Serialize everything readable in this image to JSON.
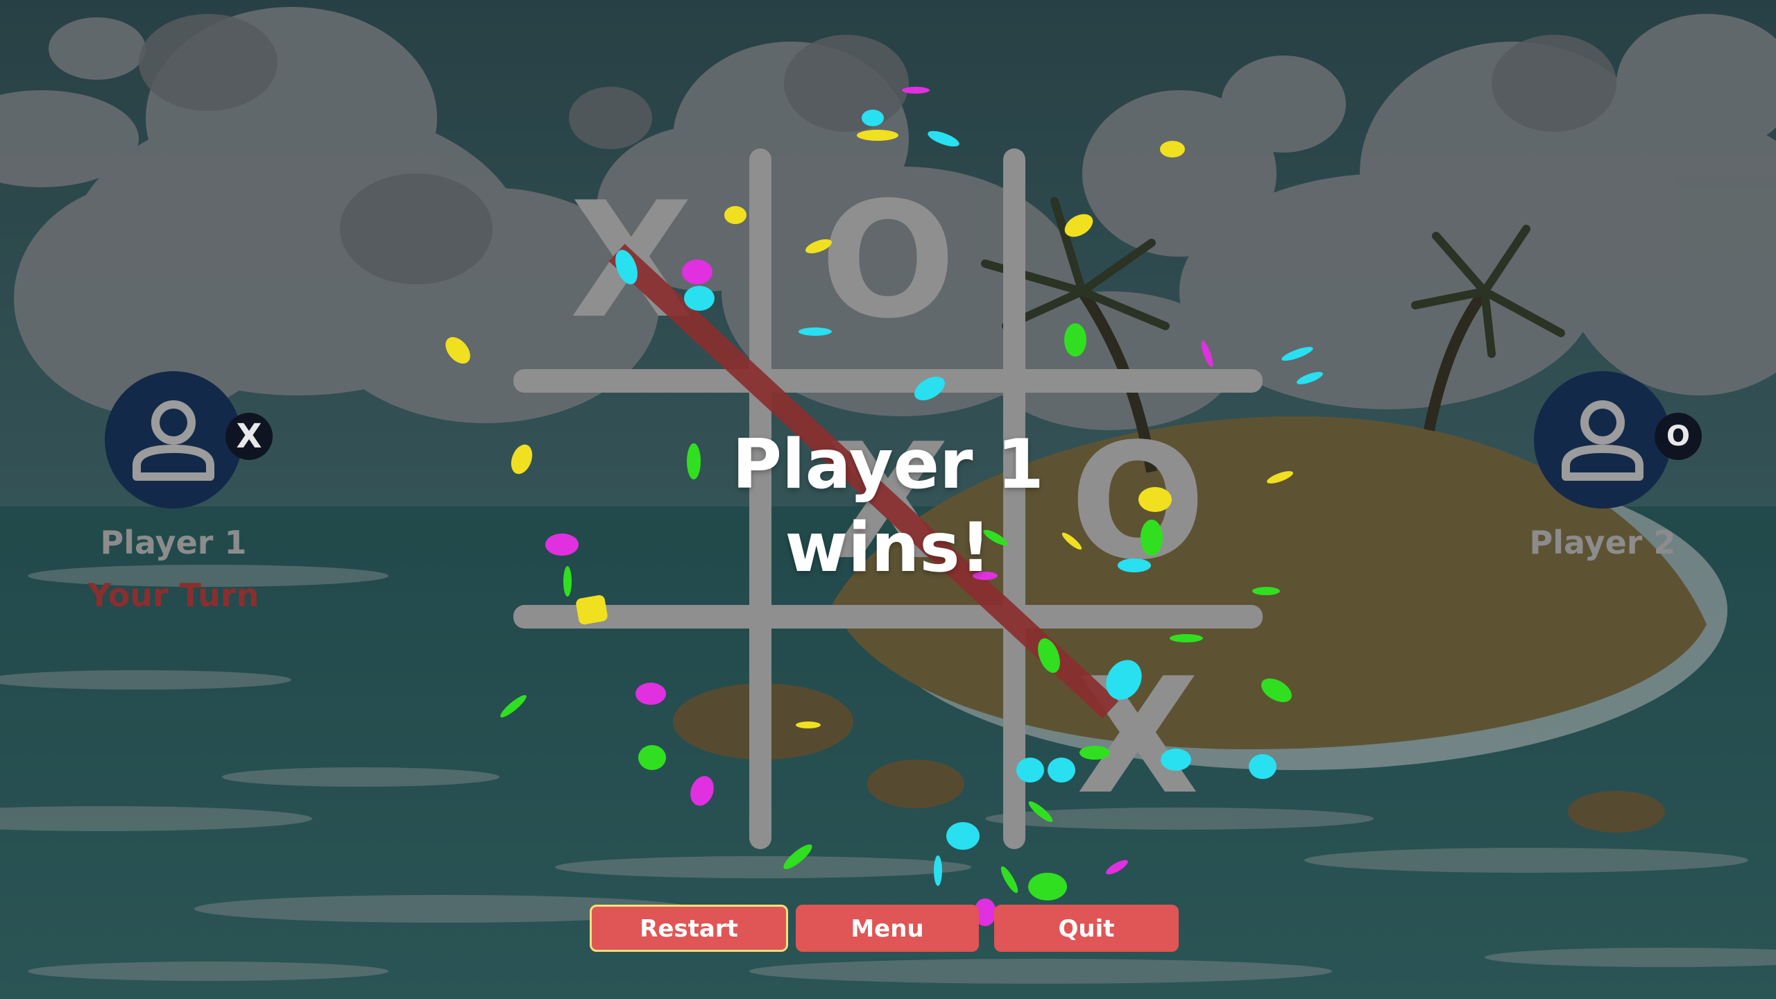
{
  "players": [
    {
      "name": "Player 1",
      "mark": "X",
      "status": "Your Turn",
      "icon": "user-icon"
    },
    {
      "name": "Player 2",
      "mark": "O",
      "status": "",
      "icon": "user-icon"
    }
  ],
  "board": [
    [
      "X",
      "O",
      ""
    ],
    [
      "",
      "X",
      "O"
    ],
    [
      "",
      "",
      "X"
    ]
  ],
  "result": {
    "message_line1": "Player 1",
    "message_line2": "wins!"
  },
  "buttons": {
    "restart": "Restart",
    "menu": "Menu",
    "quit": "Quit"
  },
  "colors": {
    "button": "#e05555",
    "button_focus_border": "#f3e27a",
    "win_line": "#8a2f2f",
    "turn_text": "#8a2e2e",
    "avatar_bg": "#13294a",
    "grid": "#8f8f8f"
  }
}
